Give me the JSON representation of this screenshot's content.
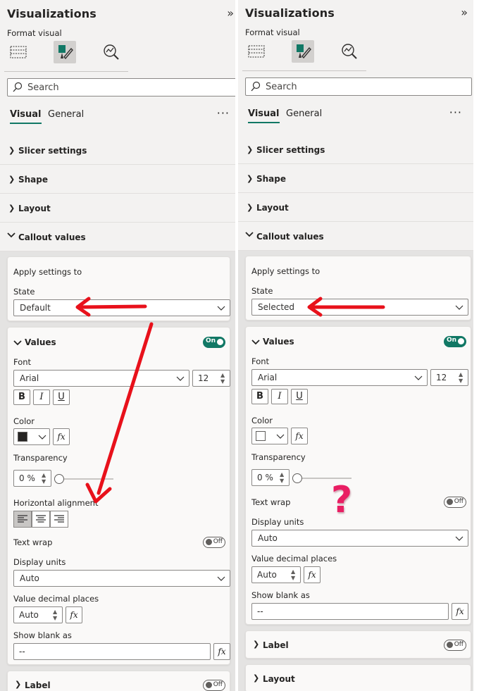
{
  "colors": {
    "accent": "#117865",
    "arrow": "#e8111b",
    "question": "#e91e63"
  },
  "panels": [
    {
      "title": "Visualizations",
      "collapse_glyph": "»",
      "subtitle": "Format visual",
      "search_placeholder": "Search",
      "tabs": [
        "Visual",
        "General"
      ],
      "more_glyph": "···",
      "sections": [
        "Slicer settings",
        "Shape",
        "Layout",
        "Callout values"
      ],
      "apply_settings": {
        "heading": "Apply settings to",
        "state_label": "State",
        "state_value": "Default"
      },
      "values": {
        "heading": "Values",
        "toggle": "On",
        "font_label": "Font",
        "font_value": "Arial",
        "font_size": "12",
        "bold": "B",
        "italic": "I",
        "underline": "U",
        "color_label": "Color",
        "color_value": "#252423",
        "fx": "fx",
        "transparency_label": "Transparency",
        "transparency_value": "0 %",
        "align_label": "Horizontal alignment",
        "wrap_label": "Text wrap",
        "wrap_toggle": "Off",
        "units_label": "Display units",
        "units_value": "Auto",
        "decimals_label": "Value decimal places",
        "decimals_value": "Auto",
        "blank_label": "Show blank as",
        "blank_value": "--"
      },
      "after_sections": [
        {
          "label": "Label",
          "toggle": "Off"
        }
      ]
    },
    {
      "title": "Visualizations",
      "collapse_glyph": "»",
      "subtitle": "Format visual",
      "search_placeholder": "Search",
      "tabs": [
        "Visual",
        "General"
      ],
      "more_glyph": "···",
      "sections": [
        "Slicer settings",
        "Shape",
        "Layout",
        "Callout values"
      ],
      "apply_settings": {
        "heading": "Apply settings to",
        "state_label": "State",
        "state_value": "Selected"
      },
      "values": {
        "heading": "Values",
        "toggle": "On",
        "font_label": "Font",
        "font_value": "Arial",
        "font_size": "12",
        "bold": "B",
        "italic": "I",
        "underline": "U",
        "color_label": "Color",
        "color_value": "#ffffff",
        "fx": "fx",
        "transparency_label": "Transparency",
        "transparency_value": "0 %",
        "wrap_label": "Text wrap",
        "wrap_toggle": "Off",
        "units_label": "Display units",
        "units_value": "Auto",
        "decimals_label": "Value decimal places",
        "decimals_value": "Auto",
        "blank_label": "Show blank as",
        "blank_value": "--"
      },
      "after_sections": [
        {
          "label": "Label",
          "toggle": "Off"
        },
        {
          "label": "Layout"
        }
      ],
      "question_mark": "?"
    }
  ]
}
